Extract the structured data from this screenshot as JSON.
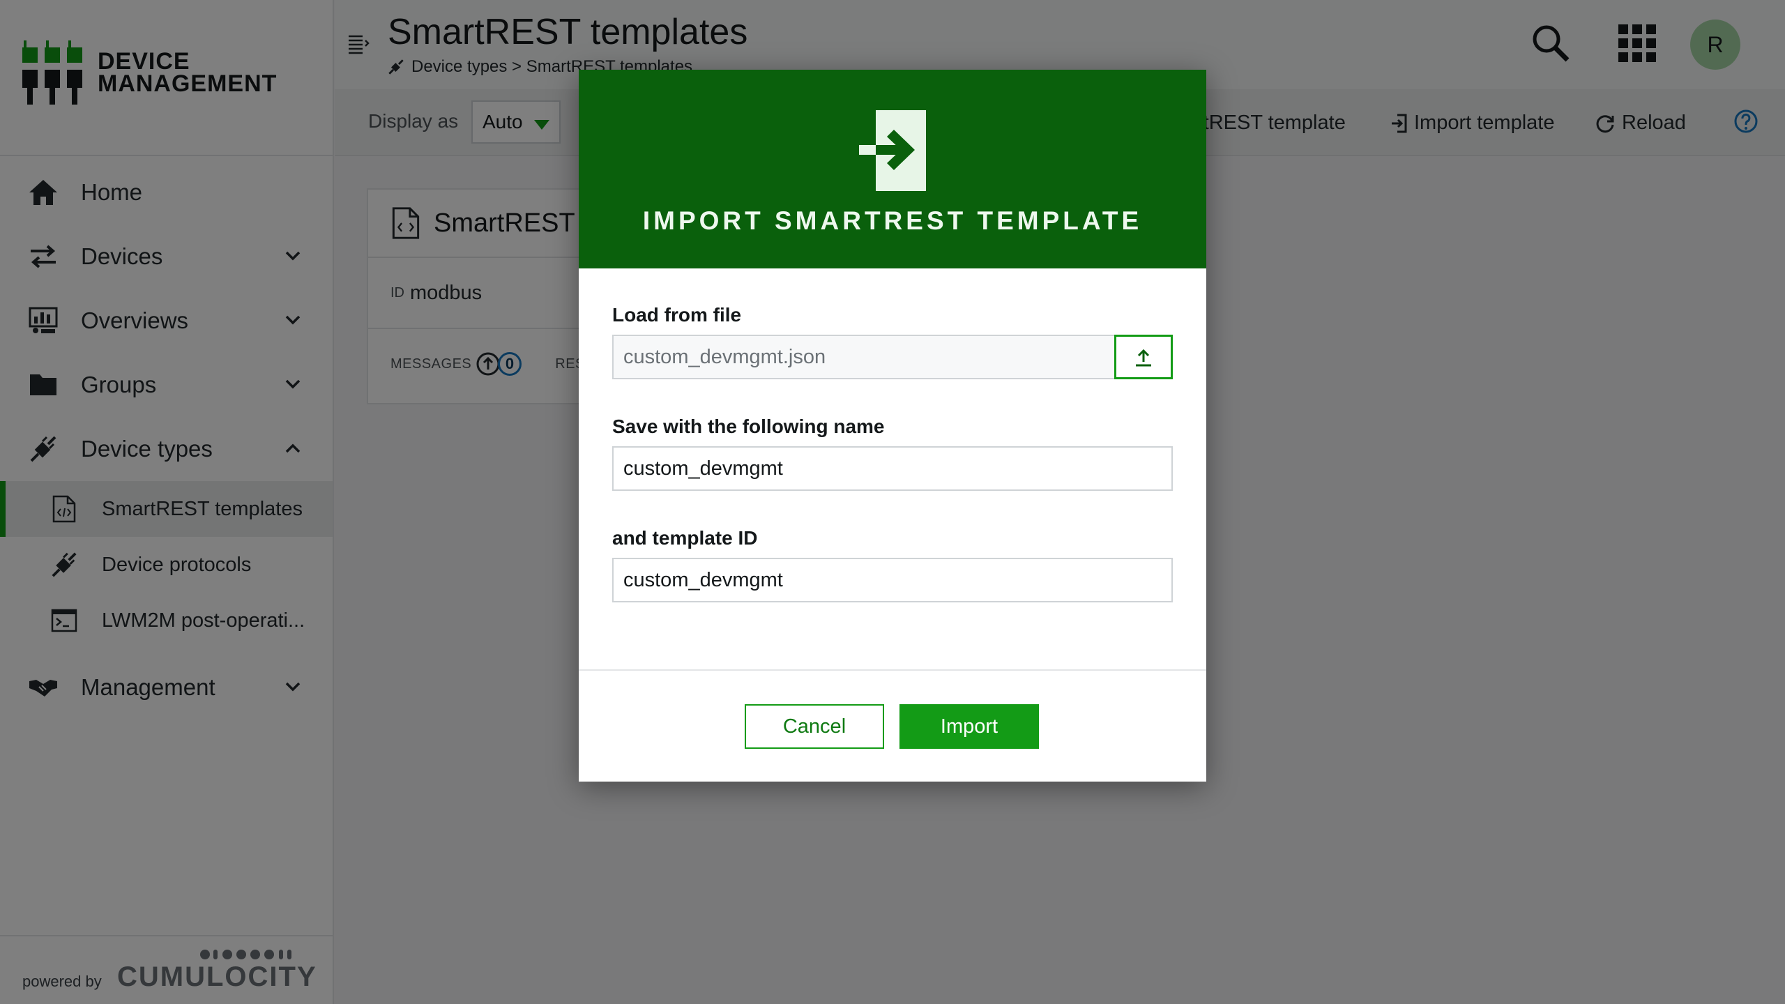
{
  "brand": {
    "line1": "DEVICE",
    "line2": "MANAGEMENT"
  },
  "sidebar": {
    "items": [
      {
        "label": "Home",
        "icon": "home-icon"
      },
      {
        "label": "Devices",
        "icon": "exchange-icon"
      },
      {
        "label": "Overviews",
        "icon": "dashboard-icon"
      },
      {
        "label": "Groups",
        "icon": "folder-icon"
      },
      {
        "label": "Device types",
        "icon": "plug-icon"
      },
      {
        "label": "Management",
        "icon": "handshake-icon"
      }
    ],
    "sub_items": [
      {
        "label": "SmartREST templates",
        "icon": "code-file-icon"
      },
      {
        "label": "Device protocols",
        "icon": "plug-icon"
      },
      {
        "label": "LWM2M post-operati...",
        "icon": "terminal-icon"
      }
    ],
    "footer": {
      "powered_by": "powered by",
      "vendor": "CUMULOCITY"
    }
  },
  "header": {
    "title": "SmartREST templates",
    "breadcrumb": "Device types > SmartREST templates",
    "avatar_initial": "R"
  },
  "actionbar": {
    "display_as_label": "Display as",
    "display_as_value": "Auto",
    "add_partial": "rtREST template",
    "import_label": "Import template",
    "reload_label": "Reload"
  },
  "card": {
    "title_partial": "SmartREST t",
    "id_label": "ID",
    "id_value": "modbus",
    "messages_label": "MESSAGES",
    "messages_count": "0",
    "responses_partial": "RES"
  },
  "modal": {
    "title": "IMPORT SMARTREST TEMPLATE",
    "load_label": "Load from file",
    "file_value": "custom_devmgmt.json",
    "name_label": "Save with the following name",
    "name_value": "custom_devmgmt",
    "id_label": "and template ID",
    "id_value": "custom_devmgmt",
    "cancel": "Cancel",
    "import": "Import"
  },
  "colors": {
    "brand_green": "#139b16",
    "header_green": "#0a600c",
    "link_blue": "#1776bf"
  }
}
